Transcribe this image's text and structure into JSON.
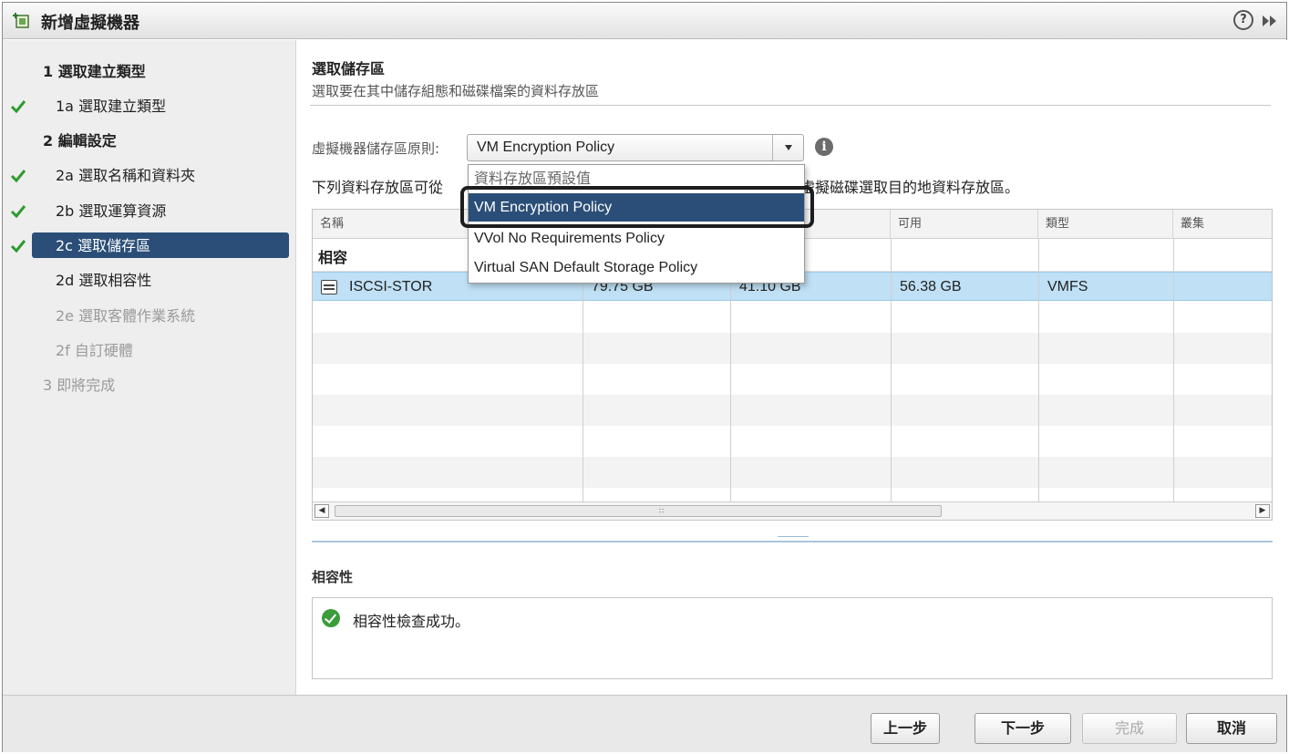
{
  "window": {
    "title": "新增虛擬機器"
  },
  "nav": {
    "items": [
      {
        "label": "1 選取建立類型",
        "checked": false,
        "state": "heading"
      },
      {
        "label": "1a 選取建立類型",
        "checked": true,
        "state": "done"
      },
      {
        "label": "2 編輯設定",
        "checked": false,
        "state": "heading"
      },
      {
        "label": "2a 選取名稱和資料夾",
        "checked": true,
        "state": "done"
      },
      {
        "label": "2b 選取運算資源",
        "checked": true,
        "state": "done"
      },
      {
        "label": "2c 選取儲存區",
        "checked": true,
        "state": "selected"
      },
      {
        "label": "2d 選取相容性",
        "checked": false,
        "state": "normal"
      },
      {
        "label": "2e 選取客體作業系統",
        "checked": false,
        "state": "disabled"
      },
      {
        "label": "2f 自訂硬體",
        "checked": false,
        "state": "disabled"
      },
      {
        "label": "3 即將完成",
        "checked": false,
        "state": "disabled-heading"
      }
    ]
  },
  "main": {
    "section_title": "選取儲存區",
    "section_desc": "選取要在其中儲存組態和磁碟檔案的資料存放區",
    "policy_label": "虛擬機器儲存區原則:",
    "policy_value": "VM Encryption Policy",
    "list_desc_left": "下列資料存放區可從",
    "list_desc_right": "所有虛擬磁碟選取目的地資料存放區。",
    "dropdown": {
      "options": [
        {
          "label": "資料存放區預設值",
          "active": false
        },
        {
          "label": "VM Encryption Policy",
          "active": true
        },
        {
          "label": "VVol No Requirements Policy",
          "active": false
        },
        {
          "label": "Virtual SAN Default Storage Policy",
          "active": false
        }
      ]
    },
    "table": {
      "columns": [
        "名稱",
        "",
        "",
        "可用",
        "類型",
        "叢集"
      ],
      "group_label": "相容",
      "rows": [
        {
          "name": "ISCSI-STOR",
          "capacity": "79.75 GB",
          "provisioned": "41.10 GB",
          "free": "56.38 GB",
          "type": "VMFS",
          "cluster": ""
        }
      ]
    },
    "compat": {
      "title": "相容性",
      "message": "相容性檢查成功。"
    }
  },
  "footer": {
    "back": "上一步",
    "next": "下一步",
    "finish": "完成",
    "cancel": "取消"
  },
  "colors": {
    "accent": "#2a4e77",
    "selected_row": "#bfe0f5",
    "check": "#2f9a2f"
  }
}
